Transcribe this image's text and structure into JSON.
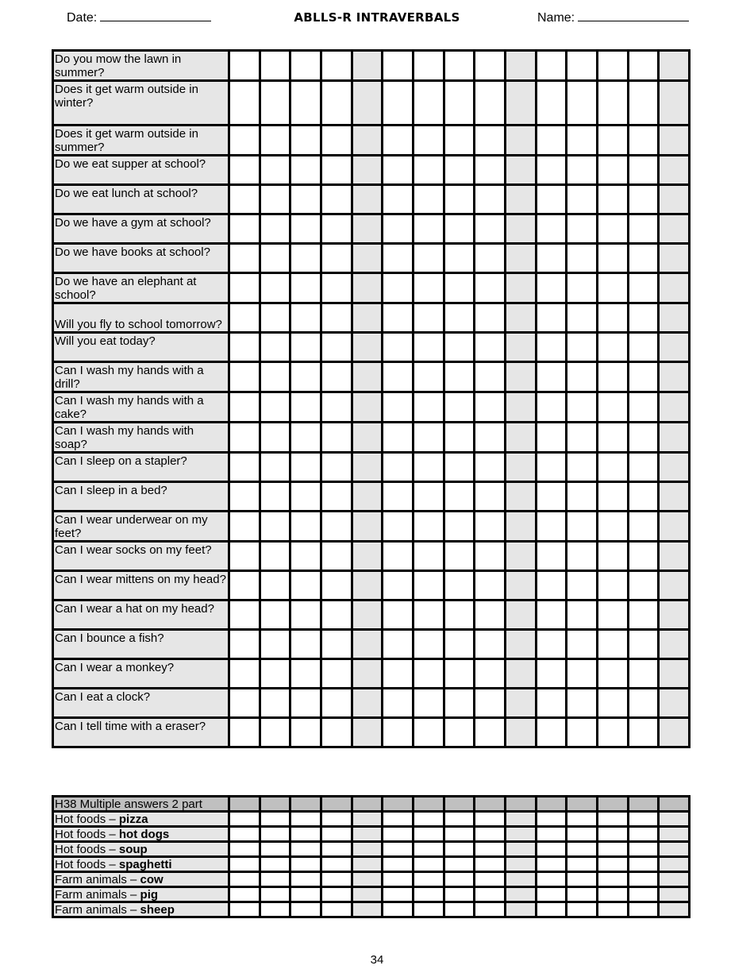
{
  "header": {
    "date_label": "Date:",
    "title": "ABLLS-R INTRAVERBALS",
    "name_label": "Name:"
  },
  "grid": {
    "trial_columns": 15,
    "shaded_columns": [
      5,
      10,
      15
    ],
    "shade_color": "#e6e6e6",
    "header_row_color": "#c0c0c0"
  },
  "table1": {
    "rows": [
      {
        "label": "Do you mow the lawn in summer?"
      },
      {
        "label": "Does it get warm outside in winter?",
        "tall": true
      },
      {
        "label": "Does it get warm outside in summer?"
      },
      {
        "label": "Do we eat supper at school?"
      },
      {
        "label": "Do we eat lunch at school?"
      },
      {
        "label": "Do we have a gym at school?"
      },
      {
        "label": "Do we have books at school?"
      },
      {
        "label": "Do we have an elephant at school?"
      },
      {
        "label": "Will you fly to school tomorrow?",
        "bottom": true
      },
      {
        "label": "Will you eat today?"
      },
      {
        "label": "Can I wash my hands with a drill?"
      },
      {
        "label": "Can I wash my hands with a cake?"
      },
      {
        "label": "Can I wash my hands with soap?"
      },
      {
        "label": "Can I sleep on a stapler?"
      },
      {
        "label": "Can I sleep in a bed?"
      },
      {
        "label": "Can I wear underwear on my feet?"
      },
      {
        "label": "Can I wear socks on my feet?"
      },
      {
        "label": "Can I wear mittens on my head?"
      },
      {
        "label": "Can I wear a hat on my head?"
      },
      {
        "label": "Can I bounce a fish?"
      },
      {
        "label": "Can I wear a monkey?"
      },
      {
        "label": "Can I eat a clock?"
      },
      {
        "label": "Can I tell time with a eraser?"
      }
    ]
  },
  "table2": {
    "header": "H38 Multiple answers 2 part",
    "rows": [
      {
        "category": "Hot foods – ",
        "answer": "pizza"
      },
      {
        "category": "Hot foods – ",
        "answer": "hot dogs"
      },
      {
        "category": "Hot foods – ",
        "answer": "soup"
      },
      {
        "category": "Hot foods – ",
        "answer": "spaghetti"
      },
      {
        "category": "Farm animals – ",
        "answer": "cow"
      },
      {
        "category": "Farm animals – ",
        "answer": "pig"
      },
      {
        "category": "Farm animals – ",
        "answer": "sheep"
      }
    ]
  },
  "footer": {
    "page_number": "34"
  }
}
